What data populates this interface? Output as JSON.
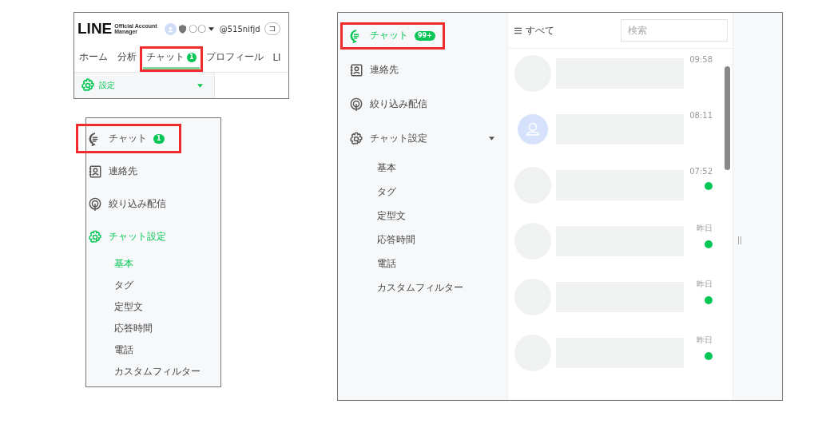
{
  "top_panel": {
    "logo": "LINE",
    "logo_sub": [
      "Official Account",
      "Manager"
    ],
    "account_name": "〇〇",
    "account_id": "@515nifjd",
    "cut_button": "コ",
    "tabs": [
      {
        "label": "ホーム",
        "selected": false,
        "highlighted": false
      },
      {
        "label": "分析",
        "selected": false,
        "highlighted": false
      },
      {
        "label": "チャット",
        "badge": "1",
        "selected": true,
        "highlighted": true
      },
      {
        "label": "プロフィール",
        "selected": false,
        "highlighted": false
      },
      {
        "label": "LI",
        "selected": false,
        "highlighted": false
      }
    ],
    "settings_label": "設定"
  },
  "left_panel": {
    "nav": [
      {
        "kind": "chat",
        "label": "チャット",
        "badge": "1",
        "selected": false,
        "highlighted": true
      },
      {
        "kind": "contacts",
        "label": "連絡先",
        "selected": false,
        "highlighted": false
      },
      {
        "kind": "broadcast",
        "label": "絞り込み配信",
        "selected": false,
        "highlighted": false
      },
      {
        "kind": "settings",
        "label": "チャット設定",
        "selected": true,
        "highlighted": false
      }
    ],
    "subitems": [
      {
        "label": "基本",
        "selected": true
      },
      {
        "label": "タグ",
        "selected": false
      },
      {
        "label": "定型文",
        "selected": false
      },
      {
        "label": "応答時間",
        "selected": false
      },
      {
        "label": "電話",
        "selected": false
      },
      {
        "label": "カスタムフィルター",
        "selected": false
      }
    ]
  },
  "main_panel": {
    "nav": [
      {
        "kind": "chat",
        "label": "チャット",
        "badge": "99+",
        "selected": true,
        "highlighted": true
      },
      {
        "kind": "contacts",
        "label": "連絡先",
        "selected": false,
        "highlighted": false
      },
      {
        "kind": "broadcast",
        "label": "絞り込み配信",
        "selected": false,
        "highlighted": false
      },
      {
        "kind": "settings",
        "label": "チャット設定",
        "selected": false,
        "highlighted": false,
        "expandable": true
      }
    ],
    "subitems": [
      {
        "label": "基本",
        "selected": false
      },
      {
        "label": "タグ",
        "selected": false
      },
      {
        "label": "定型文",
        "selected": false
      },
      {
        "label": "応答時間",
        "selected": false
      },
      {
        "label": "電話",
        "selected": false
      },
      {
        "label": "カスタムフィルター",
        "selected": false
      }
    ],
    "filter_label": "すべて",
    "search": {
      "placeholder": "検索"
    },
    "chats": [
      {
        "time": "09:58",
        "unread": false,
        "default_avatar": false
      },
      {
        "time": "08:11",
        "unread": false,
        "default_avatar": true
      },
      {
        "time": "07:52",
        "unread": true,
        "default_avatar": false
      },
      {
        "time": "昨日",
        "unread": true,
        "default_avatar": false
      },
      {
        "time": "昨日",
        "unread": true,
        "default_avatar": false
      },
      {
        "time": "昨日",
        "unread": true,
        "default_avatar": false
      }
    ]
  }
}
